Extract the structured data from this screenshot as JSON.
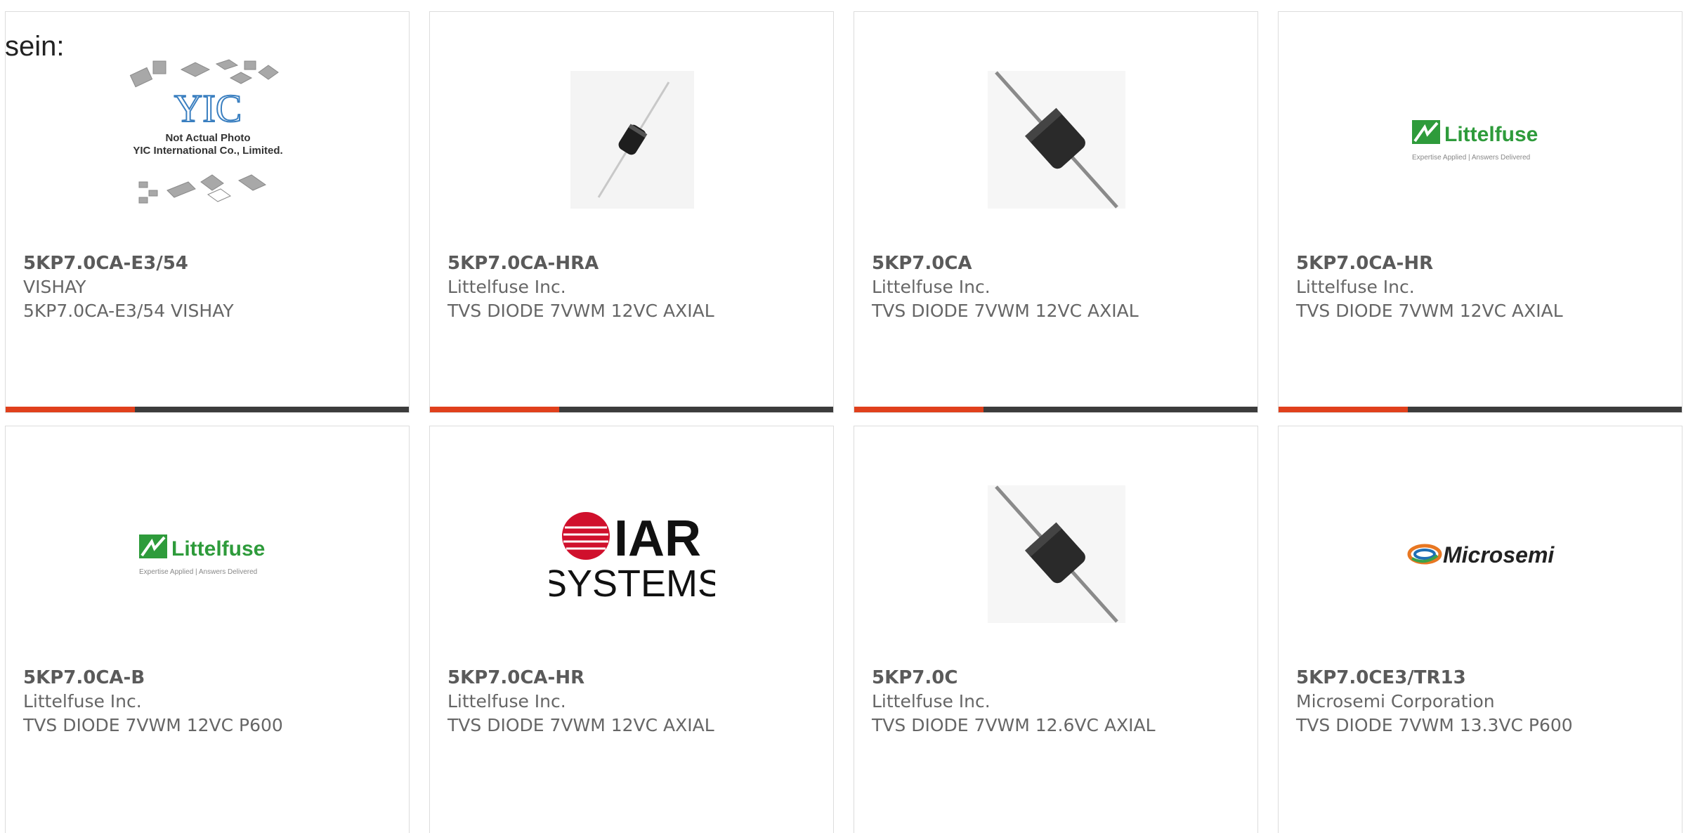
{
  "intro_text": "sein:",
  "colors": {
    "accent": "#e0401c",
    "bar_dark": "#3c3c3c",
    "text": "#666666",
    "littelfuse_green": "#2e9b3b"
  },
  "products": [
    {
      "part": "5KP7.0CA-E3/54",
      "maker": "VISHAY",
      "desc": "5KP7.0CA-E3/54 VISHAY",
      "image": "placeholder-icon",
      "placeholder": {
        "line1": "Not Actual Photo",
        "line2": "YIC International Co., Limited.",
        "logo": "YIC"
      },
      "progress": 0.32
    },
    {
      "part": "5KP7.0CA-HRA",
      "maker": "Littelfuse Inc.",
      "desc": "TVS DIODE 7VWM 12VC AXIAL",
      "image": "small-diode-icon",
      "progress": 0.32
    },
    {
      "part": "5KP7.0CA",
      "maker": "Littelfuse Inc.",
      "desc": "TVS DIODE 7VWM 12VC AXIAL",
      "image": "axial-diode-icon",
      "progress": 0.32
    },
    {
      "part": "5KP7.0CA-HR",
      "maker": "Littelfuse Inc.",
      "desc": "TVS DIODE 7VWM 12VC AXIAL",
      "image": "littelfuse-logo",
      "logo": {
        "name": "Littelfuse",
        "tagline": "Expertise Applied | Answers Delivered"
      },
      "progress": 0.32
    },
    {
      "part": "5KP7.0CA-B",
      "maker": "Littelfuse Inc.",
      "desc": "TVS DIODE 7VWM 12VC P600",
      "image": "littelfuse-logo",
      "logo": {
        "name": "Littelfuse",
        "tagline": "Expertise Applied | Answers Delivered"
      }
    },
    {
      "part": "5KP7.0CA-HR",
      "maker": "Littelfuse Inc.",
      "desc": "TVS DIODE 7VWM 12VC AXIAL",
      "image": "iar-systems-logo",
      "logo": {
        "name": "IAR",
        "tagline": "SYSTEMS"
      }
    },
    {
      "part": "5KP7.0C",
      "maker": "Littelfuse Inc.",
      "desc": "TVS DIODE 7VWM 12.6VC AXIAL",
      "image": "axial-diode-icon"
    },
    {
      "part": "5KP7.0CE3/TR13",
      "maker": "Microsemi Corporation",
      "desc": "TVS DIODE 7VWM 13.3VC P600",
      "image": "microsemi-logo",
      "logo": {
        "name": "Microsemi"
      }
    }
  ]
}
